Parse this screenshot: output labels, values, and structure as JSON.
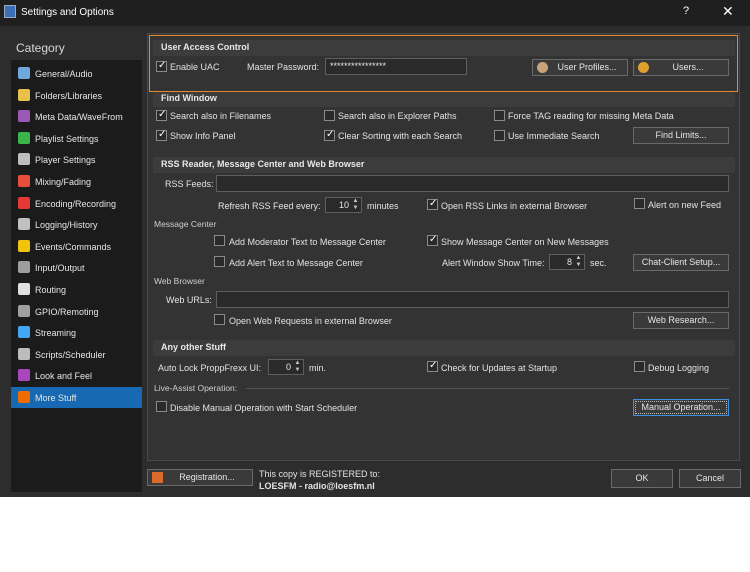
{
  "window": {
    "title": "Settings and Options",
    "help": "?",
    "close": "✕"
  },
  "sidebar": {
    "heading": "Category",
    "items": [
      {
        "label": "General/Audio",
        "icon": "music-note-icon",
        "color": "#6fa8dc"
      },
      {
        "label": "Folders/Libraries",
        "icon": "folder-icon",
        "color": "#e9c04a"
      },
      {
        "label": "Meta Data/WaveFrom",
        "icon": "waveform-icon",
        "color": "#9b59b6"
      },
      {
        "label": "Playlist Settings",
        "icon": "playlist-icon",
        "color": "#3ab54a"
      },
      {
        "label": "Player Settings",
        "icon": "player-icon",
        "color": "#bdbdbd"
      },
      {
        "label": "Mixing/Fading",
        "icon": "mixer-icon",
        "color": "#e74c3c"
      },
      {
        "label": "Encoding/Recording",
        "icon": "record-icon",
        "color": "#e53935"
      },
      {
        "label": "Logging/History",
        "icon": "log-icon",
        "color": "#c0c0c0"
      },
      {
        "label": "Events/Commands",
        "icon": "lightning-icon",
        "color": "#f1c40f"
      },
      {
        "label": "Input/Output",
        "icon": "input-output-icon",
        "color": "#9e9e9e"
      },
      {
        "label": "Routing",
        "icon": "routing-icon",
        "color": "#e0e0e0"
      },
      {
        "label": "GPIO/Remoting",
        "icon": "gpio-icon",
        "color": "#a0a0a0"
      },
      {
        "label": "Streaming",
        "icon": "streaming-icon",
        "color": "#42a5f5"
      },
      {
        "label": "Scripts/Scheduler",
        "icon": "scheduler-icon",
        "color": "#bdbdbd"
      },
      {
        "label": "Look and Feel",
        "icon": "palette-icon",
        "color": "#ab47bc"
      },
      {
        "label": "More Stuff",
        "icon": "more-stuff-icon",
        "color": "#ef6c00"
      }
    ]
  },
  "uac": {
    "title": "User Access Control",
    "enable_label": "Enable UAC",
    "password_label": "Master Password:",
    "password_value": "****************",
    "profiles_button": "User Profiles...",
    "users_button": "Users..."
  },
  "find": {
    "title": "Find Window",
    "search_filenames": "Search also in Filenames",
    "search_explorer": "Search also in Explorer Paths",
    "force_tag": "Force TAG reading for missing Meta Data",
    "show_info": "Show Info Panel",
    "clear_sorting": "Clear Sorting with each Search",
    "immediate_search": "Use Immediate Search",
    "limits_button": "Find Limits..."
  },
  "rss": {
    "title": "RSS Reader, Message Center and Web Browser",
    "feeds_label": "RSS Feeds:",
    "feeds_value": "",
    "refresh_label": "Refresh RSS Feed every:",
    "refresh_value": "10",
    "refresh_unit": "minutes",
    "open_links": "Open RSS Links in external Browser",
    "alert_new": "Alert on new Feed",
    "msg_center_heading": "Message Center",
    "add_moderator": "Add Moderator Text to Message Center",
    "show_msg_center": "Show Message Center on New Messages",
    "add_alert": "Add Alert Text to Message Center",
    "alert_time_label": "Alert Window Show Time:",
    "alert_time_value": "8",
    "alert_time_unit": "sec.",
    "chat_button": "Chat-Client Setup...",
    "web_heading": "Web Browser",
    "web_urls_label": "Web URLs:",
    "web_urls_value": "",
    "open_web": "Open Web Requests in external Browser",
    "research_button": "Web Research..."
  },
  "other": {
    "title": "Any other Stuff",
    "autolock_label": "Auto Lock ProppFrexx UI:",
    "autolock_value": "0",
    "autolock_unit": "min.",
    "check_updates": "Check for Updates at Startup",
    "debug_logging": "Debug Logging",
    "live_assist_heading": "Live-Assist Operation:",
    "disable_manual": "Disable Manual Operation with Start Scheduler",
    "manual_button": "Manual Operation..."
  },
  "footer": {
    "registration_button": "Registration...",
    "registered_line": "This copy is REGISTERED to:",
    "registered_to": "LOESFM - radio@loesfm.nl",
    "ok_button": "OK",
    "cancel_button": "Cancel"
  },
  "colors": {
    "accent": "#1769b3",
    "uac_border": "#e58a2e",
    "background": "#2d2d2d"
  }
}
